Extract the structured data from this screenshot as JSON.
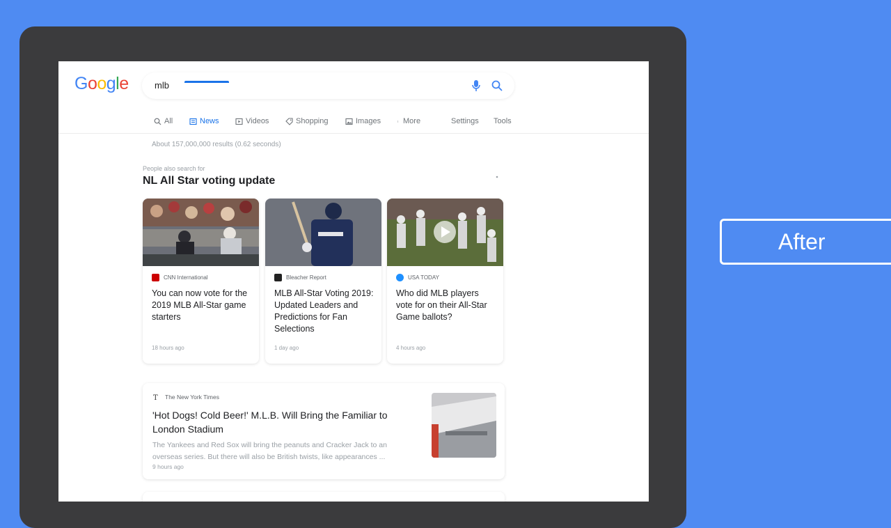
{
  "search": {
    "logo_letters": [
      {
        "ch": "G",
        "color": "#4285f4"
      },
      {
        "ch": "o",
        "color": "#ea4335"
      },
      {
        "ch": "o",
        "color": "#fbbc05"
      },
      {
        "ch": "g",
        "color": "#4285f4"
      },
      {
        "ch": "l",
        "color": "#34a853"
      },
      {
        "ch": "e",
        "color": "#ea4335"
      }
    ],
    "query": "mlb",
    "icons": [
      "mic-icon",
      "search-icon"
    ]
  },
  "tabs": [
    {
      "label": "All",
      "icon": "search-icon",
      "active": false
    },
    {
      "label": "News",
      "icon": "news-icon",
      "active": true
    },
    {
      "label": "Videos",
      "icon": "video-icon",
      "active": false
    },
    {
      "label": "Shopping",
      "icon": "tag-icon",
      "active": false
    },
    {
      "label": "Images",
      "icon": "image-icon",
      "active": false
    },
    {
      "label": "More",
      "icon": "more-vert-icon",
      "active": false
    },
    {
      "label": "Settings",
      "active": false
    },
    {
      "label": "Tools",
      "active": false
    }
  ],
  "results_stats": "About 157,000,000 results (0.62 seconds)",
  "people_also_search": {
    "label": "People also search for",
    "title": "NL All Star voting update"
  },
  "cards": [
    {
      "source": "CNN International",
      "source_color": "#cc0000",
      "title": "You can now vote for the 2019 MLB All-Star game starters",
      "age": "18 hours ago"
    },
    {
      "source": "Bleacher Report",
      "source_color": "#222222",
      "title": "MLB All-Star Voting 2019: Updated Leaders and Predictions for Fan Selections",
      "age": "1 day ago"
    },
    {
      "source": "USA TODAY",
      "source_color": "#1e90ff",
      "title": "Who did MLB players vote for on their All-Star Game ballots?",
      "age": "4 hours ago"
    }
  ],
  "news_result": {
    "source": "The New York Times",
    "title": "'Hot Dogs! Cold Beer!' M.L.B. Will Bring the Familiar to London Stadium",
    "snippet": "The Yankees and Red Sox will bring the peanuts and Cracker Jack to an overseas series. But there will also be British twists, like appearances ...",
    "age": "9 hours ago"
  },
  "overlay": {
    "label": "After"
  }
}
